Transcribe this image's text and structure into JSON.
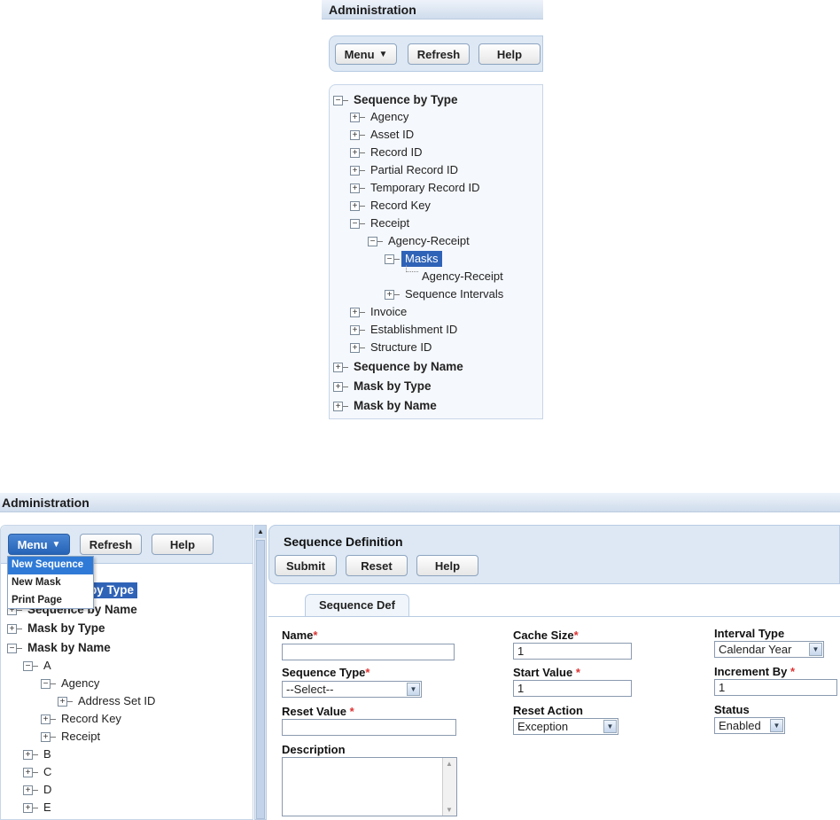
{
  "top_panel": {
    "title": "Administration",
    "buttons": {
      "menu": "Menu",
      "refresh": "Refresh",
      "help": "Help"
    },
    "tree": [
      {
        "label": "Sequence by Type",
        "bold": true
      },
      {
        "label": "Agency"
      },
      {
        "label": "Asset ID"
      },
      {
        "label": "Record ID"
      },
      {
        "label": "Partial Record ID"
      },
      {
        "label": "Temporary Record ID"
      },
      {
        "label": "Record Key"
      },
      {
        "label": "Receipt"
      },
      {
        "label": "Agency-Receipt"
      },
      {
        "label": "Masks",
        "selected": true
      },
      {
        "label": "Agency-Receipt"
      },
      {
        "label": "Sequence Intervals"
      },
      {
        "label": "Invoice"
      },
      {
        "label": "Establishment ID"
      },
      {
        "label": "Structure ID"
      },
      {
        "label": "Sequence by Name",
        "bold": true
      },
      {
        "label": "Mask by Type",
        "bold": true
      },
      {
        "label": "Mask by Name",
        "bold": true
      }
    ]
  },
  "bottom_panel": {
    "title": "Administration",
    "buttons": {
      "menu": "Menu",
      "refresh": "Refresh",
      "help": "Help"
    },
    "menu_dropdown": [
      "New Sequence",
      "New Mask",
      "Print Page"
    ],
    "tree": [
      {
        "label": "Sequence by Type",
        "bold": true,
        "selected": true,
        "visible_text": "by Type"
      },
      {
        "label": "Sequence by Name",
        "bold": true
      },
      {
        "label": "Mask by Type",
        "bold": true
      },
      {
        "label": "Mask by Name",
        "bold": true
      },
      {
        "label": "A"
      },
      {
        "label": "Agency"
      },
      {
        "label": "Address Set ID"
      },
      {
        "label": "Record Key"
      },
      {
        "label": "Receipt"
      },
      {
        "label": "B"
      },
      {
        "label": "C"
      },
      {
        "label": "D"
      },
      {
        "label": "E"
      }
    ],
    "form": {
      "heading": "Sequence Definition",
      "buttons": {
        "submit": "Submit",
        "reset": "Reset",
        "help": "Help"
      },
      "tab": "Sequence Def",
      "fields": {
        "name": {
          "label": "Name",
          "value": ""
        },
        "cache_size": {
          "label": "Cache Size",
          "value": "1"
        },
        "interval_type": {
          "label": "Interval Type",
          "value": "Calendar Year"
        },
        "sequence_type": {
          "label": "Sequence Type",
          "value": "--Select--"
        },
        "start_value": {
          "label": "Start Value",
          "value": "1"
        },
        "increment_by": {
          "label": "Increment By",
          "value": "1"
        },
        "reset_value": {
          "label": "Reset Value",
          "value": ""
        },
        "reset_action": {
          "label": "Reset Action",
          "value": "Exception"
        },
        "status": {
          "label": "Status",
          "value": "Enabled"
        },
        "description": {
          "label": "Description",
          "value": ""
        }
      },
      "required_mark": "*"
    }
  },
  "colors": {
    "selected_bg": "#2f63b7",
    "panel_bg": "#dde8f4",
    "required": "#d33333"
  }
}
